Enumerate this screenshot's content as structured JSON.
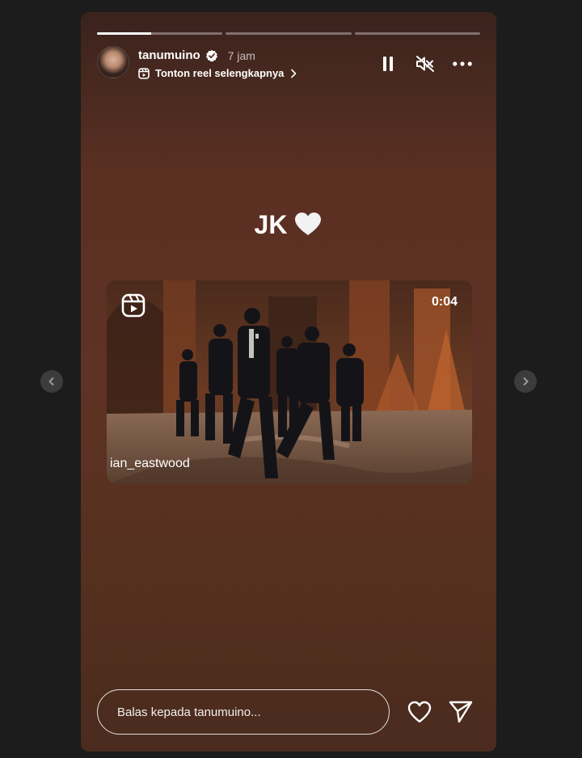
{
  "story": {
    "progress": [
      0.43,
      0,
      0
    ],
    "user": {
      "username": "tanumuino",
      "verified": true,
      "time": "7 jam",
      "reel_link": "Tonton reel selengkapnya"
    },
    "controls": {
      "pause_icon": "pause-icon",
      "mute_icon": "muted-speaker-icon",
      "more_icon": "more-options-icon"
    },
    "caption": {
      "text": "JK",
      "emoji_icon": "white-heart-icon"
    },
    "reel": {
      "duration": "0:04",
      "author": "ian_eastwood",
      "badge_icon": "reels-icon"
    },
    "reply": {
      "placeholder": "Balas kepada tanumuino..."
    },
    "actions": {
      "like_icon": "heart-outline-icon",
      "send_icon": "send-icon"
    }
  },
  "navigation": {
    "prev_icon": "chevron-left-icon",
    "next_icon": "chevron-right-icon"
  },
  "colors": {
    "page_background": "#1c1c1c",
    "story_background": "#5e3224",
    "nav_button": "#3c3c3c",
    "text": "#ffffff"
  }
}
